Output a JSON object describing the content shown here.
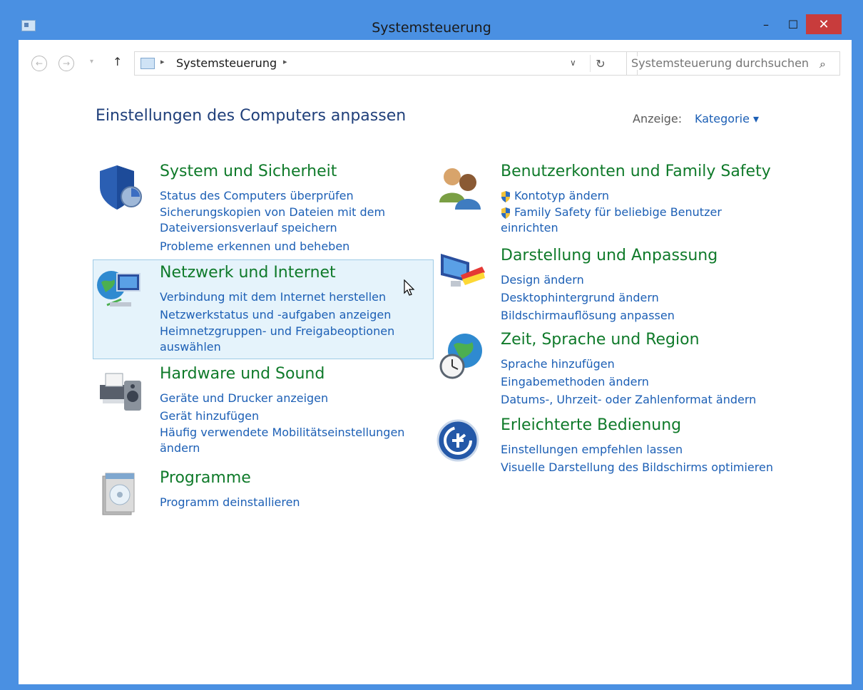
{
  "window": {
    "title": "Systemsteuerung",
    "controls": {
      "minimize": "–",
      "maximize": "☐",
      "close": "✕"
    }
  },
  "addressbar": {
    "back": "←",
    "forward": "→",
    "up": "↑",
    "path": "Systemsteuerung",
    "refresh": "↻",
    "search_placeholder": "Systemsteuerung durchsuchen"
  },
  "main": {
    "heading": "Einstellungen des Computers anpassen",
    "view_label": "Anzeige:",
    "view_value": "Kategorie ▾"
  },
  "categories": [
    {
      "title": "System und Sicherheit",
      "icon": "shield-icon",
      "links": [
        "Status des Computers überprüfen",
        "Sicherungskopien von Dateien mit dem Dateiversionsverlauf speichern",
        "Probleme erkennen und beheben"
      ]
    },
    {
      "title": "Netzwerk und Internet",
      "icon": "network-globe-icon",
      "links": [
        "Verbindung mit dem Internet herstellen",
        "Netzwerkstatus und -aufgaben anzeigen",
        "Heimnetzgruppen- und Freigabeoptionen auswählen"
      ]
    },
    {
      "title": "Hardware und Sound",
      "icon": "printer-speaker-icon",
      "links": [
        "Geräte und Drucker anzeigen",
        "Gerät hinzufügen",
        "Häufig verwendete Mobilitätseinstellungen ändern"
      ]
    },
    {
      "title": "Programme",
      "icon": "programs-box-icon",
      "links": [
        "Programm deinstallieren"
      ]
    },
    {
      "title": "Benutzerkonten und Family Safety",
      "icon": "users-icon",
      "links": [
        "Kontotyp ändern",
        "Family Safety für beliebige Benutzer einrichten"
      ]
    },
    {
      "title": "Darstellung und Anpassung",
      "icon": "display-paint-icon",
      "links": [
        "Design ändern",
        "Desktophintergrund ändern",
        "Bildschirmauflösung anpassen"
      ]
    },
    {
      "title": "Zeit, Sprache und Region",
      "icon": "globe-clock-icon",
      "links": [
        "Sprache hinzufügen",
        "Eingabemethoden ändern",
        "Datums-, Uhrzeit- oder Zahlenformat ändern"
      ]
    },
    {
      "title": "Erleichterte Bedienung",
      "icon": "accessibility-icon",
      "links": [
        "Einstellungen empfehlen lassen",
        "Visuelle Darstellung des Bildschirms optimieren"
      ]
    }
  ],
  "colors": {
    "frame": "#4a90e2",
    "category_title": "#0f7a2a",
    "link": "#1c5fb5",
    "heading": "#1f3f7a",
    "close_button": "#c83c3c",
    "hover_bg": "#e5f3fb"
  }
}
